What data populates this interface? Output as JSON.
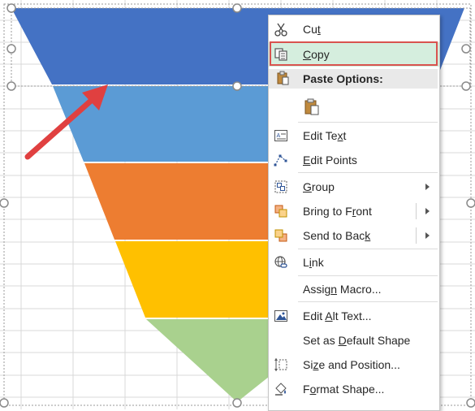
{
  "context_menu": {
    "items": [
      {
        "label": "Cut",
        "icon": "scissors-icon"
      },
      {
        "label": "Copy",
        "icon": "copy-icon",
        "highlighted": true
      },
      {
        "label": "Paste Options:",
        "icon": "paste-icon",
        "header": true
      },
      {
        "label": "",
        "icon": "paste-option-icon"
      },
      {
        "label": "Edit Text",
        "icon": "edit-text-icon"
      },
      {
        "label": "Edit Points",
        "icon": "edit-points-icon"
      },
      {
        "label": "Group",
        "icon": "group-icon",
        "submenu": true
      },
      {
        "label": "Bring to Front",
        "icon": "bring-to-front-icon",
        "submenu": true
      },
      {
        "label": "Send to Back",
        "icon": "send-to-back-icon",
        "submenu": true
      },
      {
        "label": "Link",
        "icon": "link-icon"
      },
      {
        "label": "Assign Macro...",
        "icon": ""
      },
      {
        "label": "Edit Alt Text...",
        "icon": "alt-text-icon"
      },
      {
        "label": "Set as Default Shape",
        "icon": ""
      },
      {
        "label": "Size and Position...",
        "icon": "size-position-icon"
      },
      {
        "label": "Format Shape...",
        "icon": "format-shape-icon"
      }
    ]
  },
  "funnel": {
    "segments": [
      "#4472c4",
      "#5b9bd5",
      "#ed7d31",
      "#ffc000",
      "#a9d18e"
    ]
  },
  "colors": {
    "highlight": "#d5eede",
    "highlight_border": "#d9534f",
    "arrow": "#e04040",
    "gridline": "#d9d9d9"
  }
}
